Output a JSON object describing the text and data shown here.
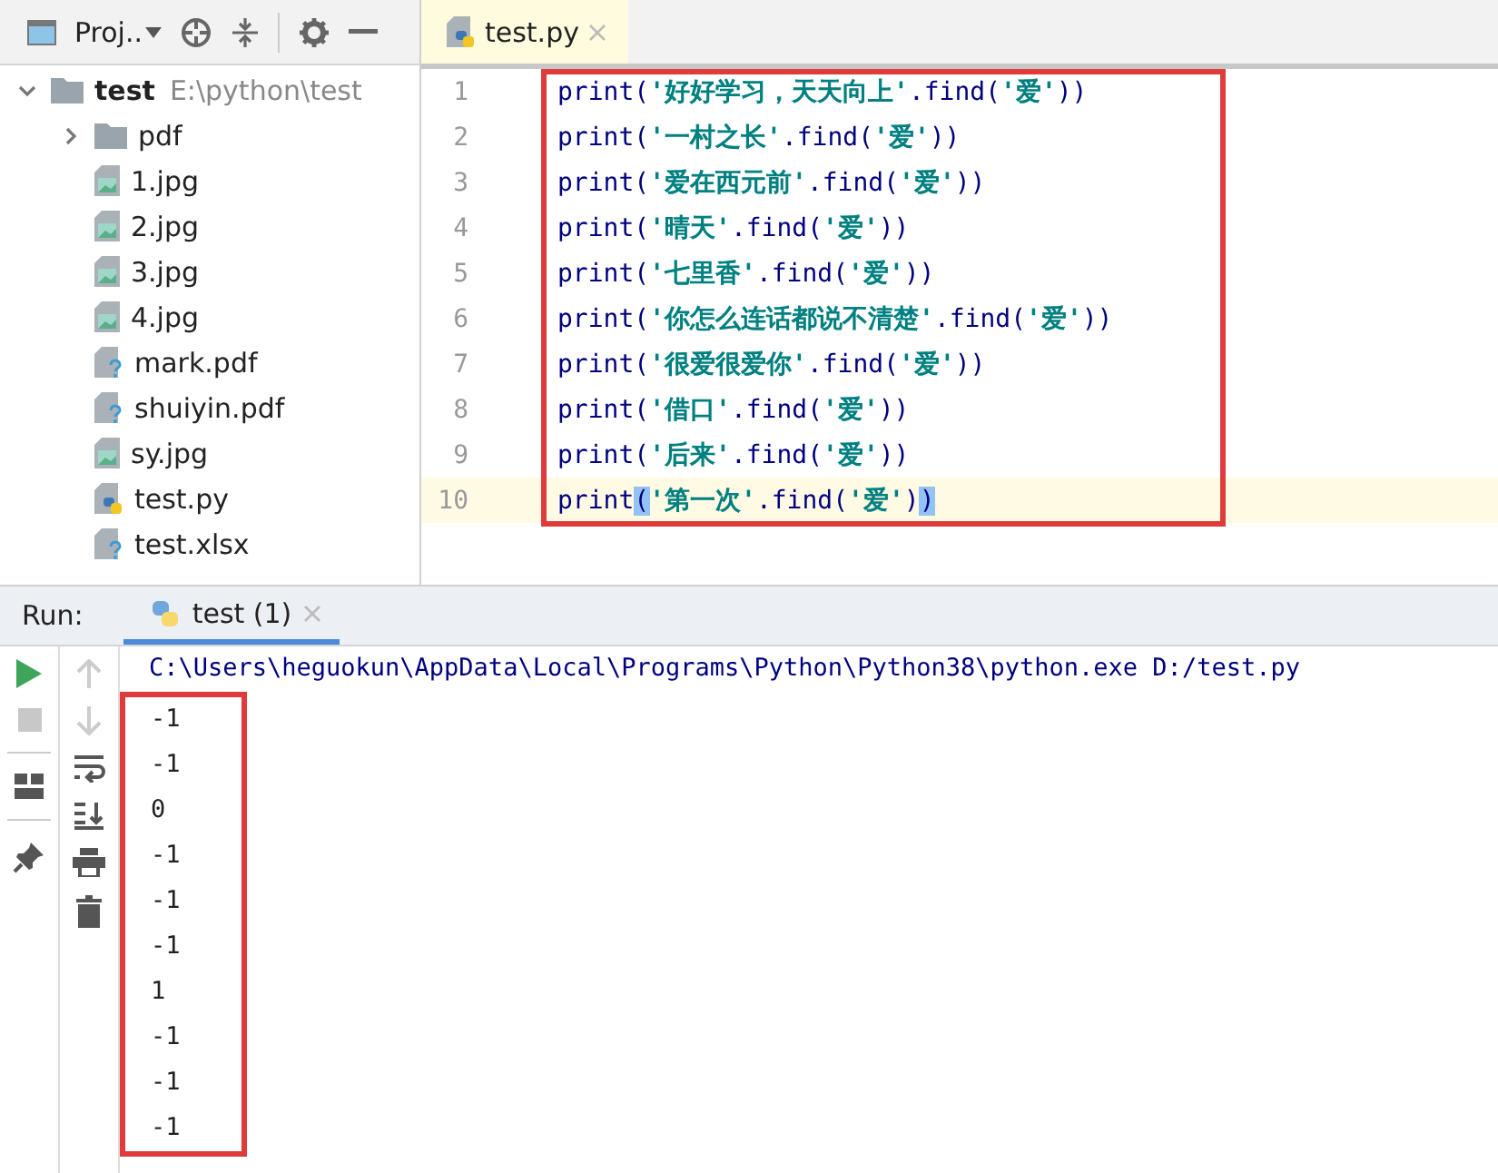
{
  "project_panel": {
    "title": "Proj..",
    "tree": [
      {
        "name": "test",
        "path": "E:\\python\\test",
        "kind": "folder",
        "expanded": true,
        "children": [
          {
            "name": "pdf",
            "kind": "folder",
            "expanded": false
          },
          {
            "name": "1.jpg",
            "kind": "image"
          },
          {
            "name": "2.jpg",
            "kind": "image"
          },
          {
            "name": "3.jpg",
            "kind": "image"
          },
          {
            "name": "4.jpg",
            "kind": "image"
          },
          {
            "name": "mark.pdf",
            "kind": "unknown"
          },
          {
            "name": "shuiyin.pdf",
            "kind": "unknown"
          },
          {
            "name": "sy.jpg",
            "kind": "image"
          },
          {
            "name": "test.py",
            "kind": "python"
          },
          {
            "name": "test.xlsx",
            "kind": "unknown"
          }
        ]
      }
    ]
  },
  "editor": {
    "tabs": [
      {
        "label": "test.py",
        "selected": true
      }
    ],
    "lines": [
      {
        "number": "1",
        "current": false,
        "tokens": [
          {
            "kind": "plain",
            "text": "print("
          },
          {
            "kind": "string",
            "text": "'好好学习，天天向上'"
          },
          {
            "kind": "plain",
            "text": ".find("
          },
          {
            "kind": "string",
            "text": "'爱'"
          },
          {
            "kind": "plain",
            "text": "))"
          }
        ]
      },
      {
        "number": "2",
        "current": false,
        "tokens": [
          {
            "kind": "plain",
            "text": "print("
          },
          {
            "kind": "string",
            "text": "'一村之长'"
          },
          {
            "kind": "plain",
            "text": ".find("
          },
          {
            "kind": "string",
            "text": "'爱'"
          },
          {
            "kind": "plain",
            "text": "))"
          }
        ]
      },
      {
        "number": "3",
        "current": false,
        "tokens": [
          {
            "kind": "plain",
            "text": "print("
          },
          {
            "kind": "string",
            "text": "'爱在西元前'"
          },
          {
            "kind": "plain",
            "text": ".find("
          },
          {
            "kind": "string",
            "text": "'爱'"
          },
          {
            "kind": "plain",
            "text": "))"
          }
        ]
      },
      {
        "number": "4",
        "current": false,
        "tokens": [
          {
            "kind": "plain",
            "text": "print("
          },
          {
            "kind": "string",
            "text": "'晴天'"
          },
          {
            "kind": "plain",
            "text": ".find("
          },
          {
            "kind": "string",
            "text": "'爱'"
          },
          {
            "kind": "plain",
            "text": "))"
          }
        ]
      },
      {
        "number": "5",
        "current": false,
        "tokens": [
          {
            "kind": "plain",
            "text": "print("
          },
          {
            "kind": "string",
            "text": "'七里香'"
          },
          {
            "kind": "plain",
            "text": ".find("
          },
          {
            "kind": "string",
            "text": "'爱'"
          },
          {
            "kind": "plain",
            "text": "))"
          }
        ]
      },
      {
        "number": "6",
        "current": false,
        "tokens": [
          {
            "kind": "plain",
            "text": "print("
          },
          {
            "kind": "string",
            "text": "'你怎么连话都说不清楚'"
          },
          {
            "kind": "plain",
            "text": ".find("
          },
          {
            "kind": "string",
            "text": "'爱'"
          },
          {
            "kind": "plain",
            "text": "))"
          }
        ]
      },
      {
        "number": "7",
        "current": false,
        "tokens": [
          {
            "kind": "plain",
            "text": "print("
          },
          {
            "kind": "string",
            "text": "'很爱很爱你'"
          },
          {
            "kind": "plain",
            "text": ".find("
          },
          {
            "kind": "string",
            "text": "'爱'"
          },
          {
            "kind": "plain",
            "text": "))"
          }
        ]
      },
      {
        "number": "8",
        "current": false,
        "tokens": [
          {
            "kind": "plain",
            "text": "print("
          },
          {
            "kind": "string",
            "text": "'借口'"
          },
          {
            "kind": "plain",
            "text": ".find("
          },
          {
            "kind": "string",
            "text": "'爱'"
          },
          {
            "kind": "plain",
            "text": "))"
          }
        ]
      },
      {
        "number": "9",
        "current": false,
        "tokens": [
          {
            "kind": "plain",
            "text": "print("
          },
          {
            "kind": "string",
            "text": "'后来'"
          },
          {
            "kind": "plain",
            "text": ".find("
          },
          {
            "kind": "string",
            "text": "'爱'"
          },
          {
            "kind": "plain",
            "text": "))"
          }
        ]
      },
      {
        "number": "10",
        "current": true,
        "tokens": [
          {
            "kind": "plain",
            "text": "print"
          },
          {
            "kind": "match",
            "text": "("
          },
          {
            "kind": "string",
            "text": "'第一次'"
          },
          {
            "kind": "plain",
            "text": ".find("
          },
          {
            "kind": "string",
            "text": "'爱'"
          },
          {
            "kind": "plain",
            "text": ")"
          },
          {
            "kind": "match",
            "text": ")"
          }
        ]
      }
    ]
  },
  "run_panel": {
    "label": "Run:",
    "tabs": [
      {
        "label": "test (1)",
        "selected": true
      }
    ],
    "command": "C:\\Users\\heguokun\\AppData\\Local\\Programs\\Python\\Python38\\python.exe D:/test.py",
    "output": [
      "-1",
      "-1",
      "0",
      "-1",
      "-1",
      "-1",
      "1",
      "-1",
      "-1",
      "-1"
    ]
  }
}
